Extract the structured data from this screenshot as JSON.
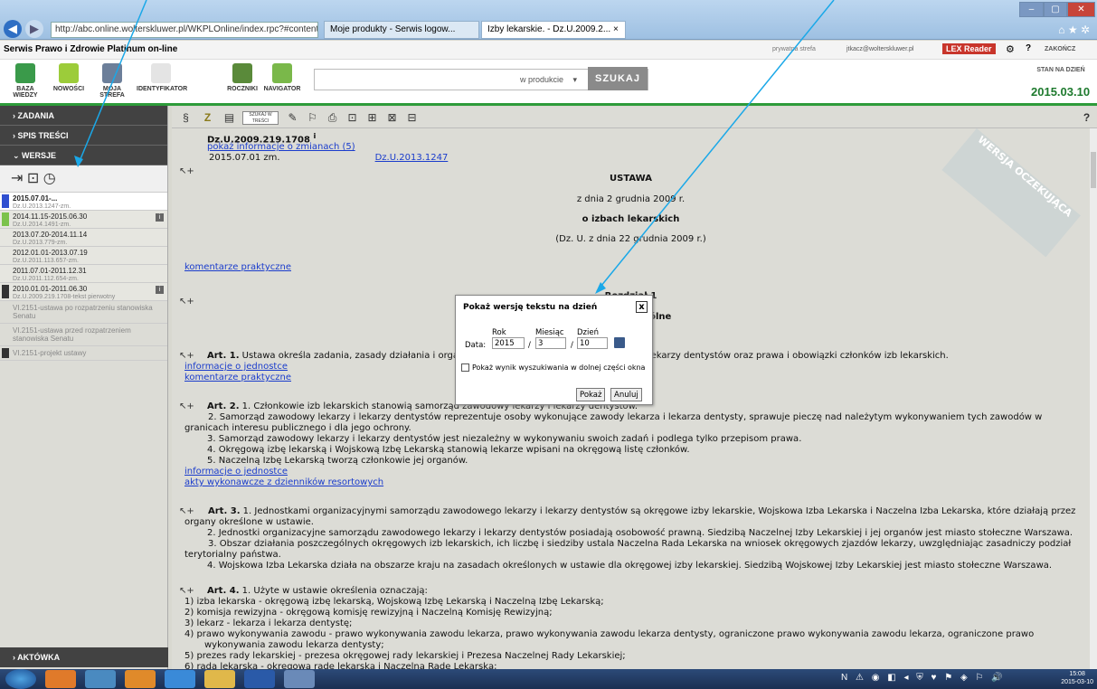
{
  "browser": {
    "address": "http://abc.online.wolterskluwer.pl/WKPLOnline/index.rpc?#content.rpc-- ⍴ ▾ C",
    "tabs": [
      "Moje produkty - Serwis logow...",
      "Izby lekarskie. - Dz.U.2009.2..."
    ],
    "tab_close": "×",
    "win_buttons": [
      "–",
      "▢",
      "✕"
    ],
    "right_icons": "⌂ ★ ✲"
  },
  "app": {
    "title": "Serwis Prawo i Zdrowie Platinum on-line",
    "bar_items": [
      "prywatna strefa",
      "jtkacz@wolterskluwer.pl",
      "LEX Reader",
      "⚙",
      "?",
      "ZAKOŃCZ"
    ]
  },
  "toolbar": {
    "tools": [
      "BAZA WIEDZY",
      "NOWOŚCI",
      "MOJA STREFA",
      "IDENTYFIKATOR",
      "ROCZNIKI",
      "NAVIGATOR"
    ],
    "search_value": "",
    "search_scope": "w produkcie",
    "search_button": "SZUKAJ",
    "stan_label": "STAN NA DZIEŃ",
    "stan_date": "2015.03.10"
  },
  "sidebar": {
    "zadania": "ZADANIA",
    "spis": "SPIS TREŚCI",
    "wersje": "WERSJE",
    "ver_icons": "⇥ ⊡ ◷",
    "versions": [
      {
        "t": "2015.07.01-...",
        "s": "Dz.U.2013.1247-zm."
      },
      {
        "t": "2014.11.15-2015.06.30",
        "s": "Dz.U.2014.1491-zm."
      },
      {
        "t": "2013.07.20-2014.11.14",
        "s": "Dz.U.2013.779-zm."
      },
      {
        "t": "2012.01.01-2013.07.19",
        "s": "Dz.U.2011.113.657-zm."
      },
      {
        "t": "2011.07.01-2011.12.31",
        "s": "Dz.U.2011.112.654-zm."
      },
      {
        "t": "2010.01.01-2011.06.30",
        "s": "Dz.U.2009.219.1708-tekst pierwotny"
      }
    ],
    "info_badge": "i",
    "grey_items": [
      "VI.2151-ustawa po rozpatrzeniu stanowiska Senatu",
      "VI.2151-ustawa przed rozpatrzeniem stanowiska Senatu",
      "VI.2151-projekt ustawy"
    ],
    "aktowka": "AKTÓWKA"
  },
  "doctoolbar": {
    "icons": [
      "§",
      "Z",
      "▤",
      "SZUKAJ W TREŚCI",
      "✎",
      "⚐",
      "⎙",
      "⊡",
      "⊞",
      "⊠",
      "⊟"
    ],
    "help": "?"
  },
  "document": {
    "ref": "Dz.U.2009.219.1708",
    "ref_sup": "i",
    "show_changes": "pokaż informacje o zmianach (5)",
    "date_line": "2015.07.01    zm.",
    "date_link": "Dz.U.2013.1247",
    "stamp": "WERSJA OCZEKUJĄCA",
    "h1": "USTAWA",
    "h2": "z dnia 2 grudnia 2009 r.",
    "h3": "o izbach lekarskich",
    "h4": "(Dz. U. z dnia 22 grudnia 2009 r.)",
    "komentarze": "komentarze praktyczne",
    "rozdzial": "Rozdział 1",
    "przepisy": "Przepisy ogólne",
    "art1_head": "Art. 1.",
    "art1": " Ustawa określa zadania, zasady działania i organizację samorządu zawodowego lekarzy i lekarzy dentystów oraz prawa i obowiązki członków izb lekarskich.",
    "info_jedn": "informacje o jednostce",
    "art2_head": "Art. 2.",
    "art2_1": " 1. Członkowie izb lekarskich stanowią samorząd zawodowy lekarzy i lekarzy dentystów.",
    "art2_2": "2. Samorząd zawodowy lekarzy i lekarzy dentystów reprezentuje osoby wykonujące zawody lekarza i lekarza dentysty, sprawuje pieczę nad należytym wykonywaniem tych zawodów w granicach interesu publicznego i dla jego ochrony.",
    "art2_3": "3. Samorząd zawodowy lekarzy i lekarzy dentystów jest niezależny w wykonywaniu swoich zadań i podlega tylko przepisom prawa.",
    "art2_4": "4. Okręgową izbę lekarską i Wojskową Izbę Lekarską stanowią lekarze wpisani na okręgową listę członków.",
    "art2_5": "5. Naczelną Izbę Lekarską tworzą członkowie jej organów.",
    "akty": "akty wykonawcze z dzienników resortowych",
    "art3_head": "Art. 3.",
    "art3_1": " 1. Jednostkami organizacyjnymi samorządu zawodowego lekarzy i lekarzy dentystów są okręgowe izby lekarskie, Wojskowa Izba Lekarska i Naczelna Izba Lekarska, które działają przez organy określone w ustawie.",
    "art3_2": "2. Jednostki organizacyjne samorządu zawodowego lekarzy i lekarzy dentystów posiadają osobowość prawną. Siedzibą Naczelnej Izby Lekarskiej i jej organów jest miasto stołeczne Warszawa.",
    "art3_3": "3. Obszar działania poszczególnych okręgowych izb lekarskich, ich liczbę i siedziby ustala Naczelna Rada Lekarska na wniosek okręgowych zjazdów lekarzy, uwzględniając zasadniczy podział terytorialny państwa.",
    "art3_4": "4. Wojskowa Izba Lekarska działa na obszarze kraju na zasadach określonych w ustawie dla okręgowej izby lekarskiej. Siedzibą Wojskowej Izby Lekarskiej jest miasto stołeczne Warszawa.",
    "art4_head": "Art. 4.",
    "art4_1": " 1. Użyte w ustawie określenia oznaczają:",
    "art4_items": [
      "1)  izba lekarska - okręgową izbę lekarską, Wojskową Izbę Lekarską i Naczelną Izbę Lekarską;",
      "2)  komisja rewizyjna - okręgową komisję rewizyjną i Naczelną Komisję Rewizyjną;",
      "3)  lekarz - lekarza i lekarza dentystę;",
      "4)  prawo wykonywania zawodu - prawo wykonywania zawodu lekarza, prawo wykonywania zawodu lekarza dentysty, ograniczone prawo wykonywania zawodu lekarza, ograniczone prawo wykonywania zawodu lekarza dentysty;",
      "5)  prezes rady lekarskiej - prezesa okręgowej rady lekarskiej i Prezesa Naczelnej Rady Lekarskiej;",
      "6)  rada lekarska - okręgową radę lekarską i Naczelną Radę Lekarską;"
    ],
    "margin_icon": "↖+"
  },
  "dialog": {
    "title": "Pokaż wersję tekstu na dzień",
    "close": "x",
    "rok_label": "Rok",
    "miesiac_label": "Miesiąc",
    "dzien_label": "Dzień",
    "data_label": "Data:",
    "year": "2015",
    "month": "3",
    "day": "10",
    "sep": "/",
    "checkbox_label": "Pokaż wynik wyszukiwania w dolnej części okna",
    "ok": "Pokaż",
    "cancel": "Anuluj"
  },
  "taskbar": {
    "time": "15:08",
    "date": "2015-03-10",
    "tray": "N ⚠ ◉ ◧ ◂ ⛨ ♥ ⚑ ◈ ⚐ 🔊"
  },
  "colors": {
    "accent_green": "#2d9b3a",
    "link_blue": "#1a3ccc",
    "annotation_arrow": "#1aa8e8"
  }
}
